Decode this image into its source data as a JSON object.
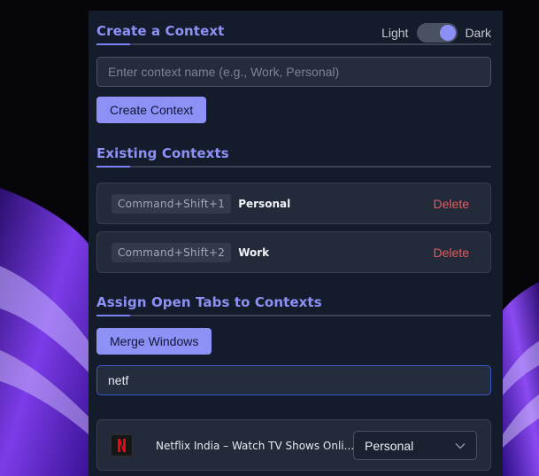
{
  "create_section": {
    "title": "Create a Context",
    "input_placeholder": "Enter context name (e.g., Work, Personal)",
    "input_value": "",
    "button_label": "Create Context"
  },
  "theme_toggle": {
    "light_label": "Light",
    "dark_label": "Dark",
    "state": "dark"
  },
  "existing_section": {
    "title": "Existing Contexts",
    "contexts": [
      {
        "shortcut": "Command+Shift+1",
        "name": "Personal",
        "delete_label": "Delete"
      },
      {
        "shortcut": "Command+Shift+2",
        "name": "Work",
        "delete_label": "Delete"
      }
    ]
  },
  "assign_section": {
    "title": "Assign Open Tabs to Contexts",
    "merge_button_label": "Merge Windows",
    "search_value": "netf",
    "tabs": [
      {
        "title": "Netflix India – Watch TV Shows Onli...",
        "favicon": "netflix-icon",
        "context": "Personal"
      }
    ]
  },
  "colors": {
    "accent": "#8d91f6",
    "panel_bg": "#141b2a",
    "card_bg": "#232b3b",
    "delete": "#e45b5e",
    "netflix_red": "#e50914"
  }
}
